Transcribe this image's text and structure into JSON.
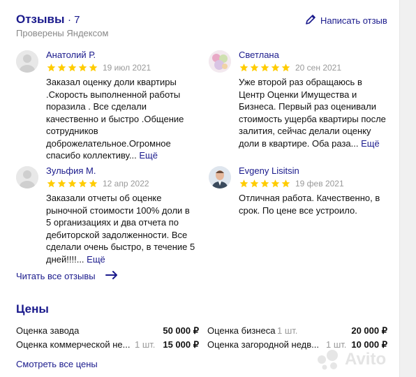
{
  "reviews_section": {
    "title": "Отзывы",
    "count": "· 7",
    "subtitle": "Проверены Яндексом",
    "write_label": "Написать отзыв",
    "read_all_label": "Читать все отзывы"
  },
  "reviews": [
    {
      "name": "Анатолий Р.",
      "rating": 5,
      "date": "19 июл 2021",
      "text": "Заказал оценку доли квартиры .Скорость выполненной работы поразила . Все сделали качественно и быстро .Общение сотрудников доброжелательное.Огромное спасибо коллективу...",
      "more": "Ещё"
    },
    {
      "name": "Светлана",
      "rating": 5,
      "date": "20 сен 2021",
      "text": "Уже второй раз обращаюсь в Центр Оценки Имущества и Бизнеса. Первый раз оценивали стоимость ущерба квартиры после залития, сейчас делали оценку доли в квартире. Оба раза...",
      "more": "Ещё"
    },
    {
      "name": "Зульфия М.",
      "rating": 5,
      "date": "12 апр 2022",
      "text": "Заказали отчеты об оценке рыночной стоимости 100% доли в 5 организациях и два отчета по дебиторской задолженности. Все сделали очень быстро, в течение 5 дней!!!!...",
      "more": "Ещё"
    },
    {
      "name": "Evgeny Lisitsin",
      "rating": 5,
      "date": "19 фев 2021",
      "text": "Отличная работа. Качественно, в срок. По цене все устроило.",
      "more": ""
    }
  ],
  "prices_section": {
    "title": "Цены",
    "see_all_label": "Смотреть все цены",
    "items": [
      {
        "name": "Оценка завода",
        "unit": "",
        "value": "50 000 ₽"
      },
      {
        "name": "Оценка бизнеса",
        "unit": "1 шт.",
        "value": "20 000 ₽"
      },
      {
        "name": "Оценка коммерческой не...",
        "unit": "1 шт.",
        "value": "15 000 ₽"
      },
      {
        "name": "Оценка загородной недв...",
        "unit": "1 шт.",
        "value": "10 000 ₽"
      }
    ]
  },
  "watermark": "Avito",
  "colors": {
    "accent": "#1a1a8c",
    "star": "#ffcc00",
    "muted": "#999999"
  },
  "icons": [
    "pencil-icon",
    "star-icon",
    "arrow-right-icon",
    "avatar-placeholder-icon"
  ]
}
